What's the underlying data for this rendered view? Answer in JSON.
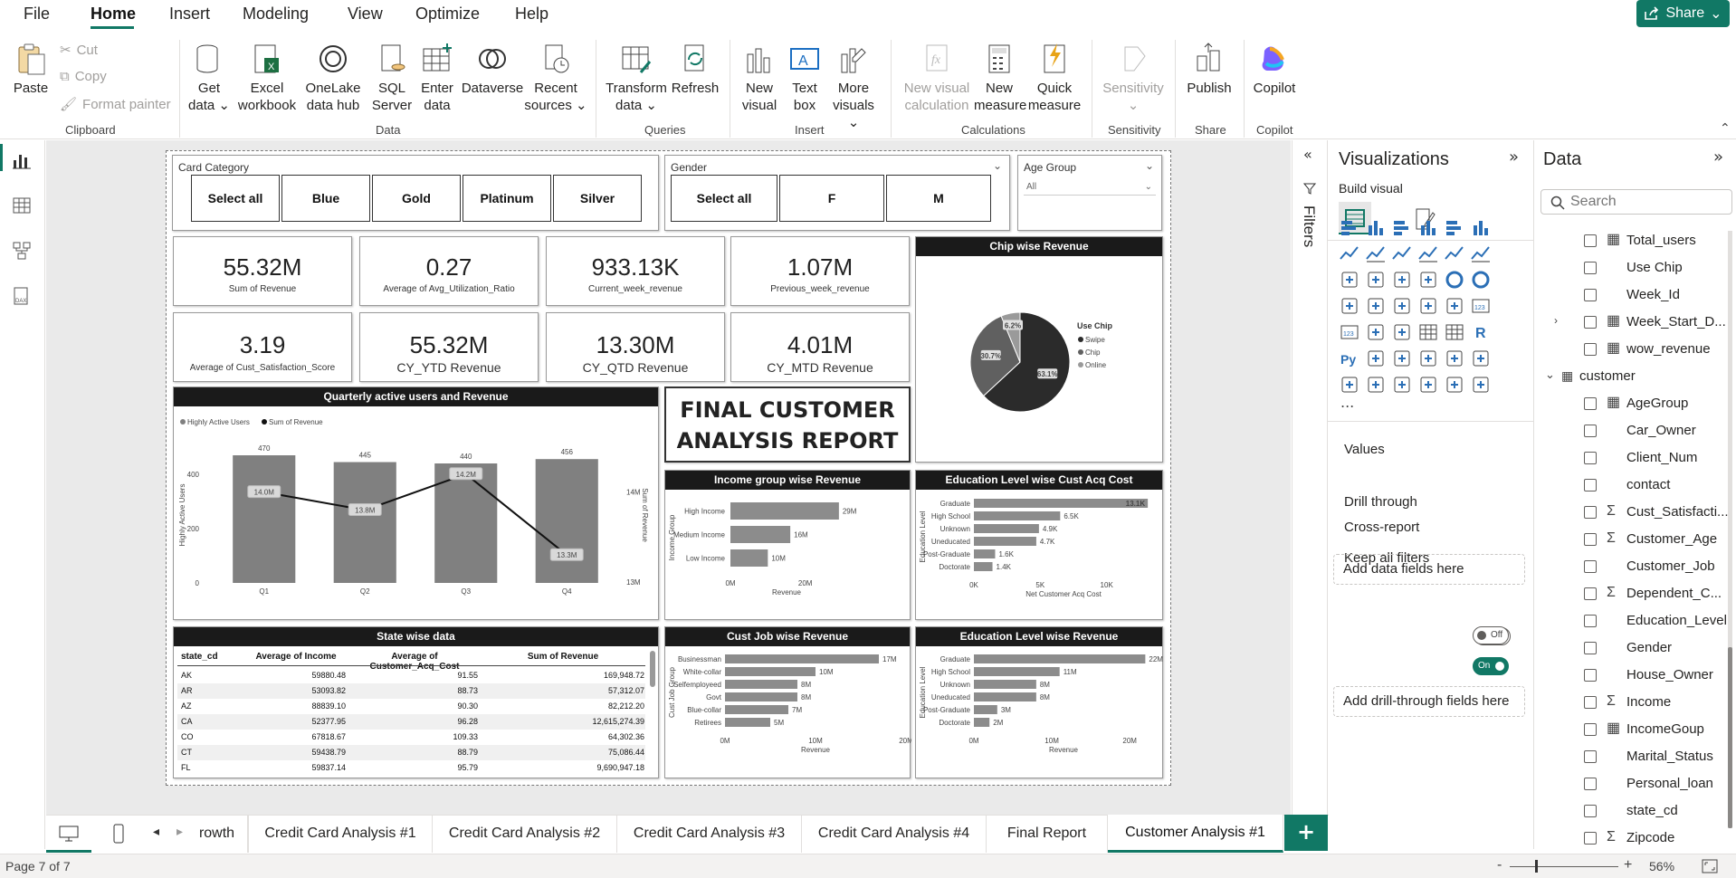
{
  "menu": {
    "file": "File",
    "home": "Home",
    "insert": "Insert",
    "modeling": "Modeling",
    "view": "View",
    "optimize": "Optimize",
    "help": "Help",
    "share": "Share"
  },
  "ribbon": {
    "paste": "Paste",
    "cut": "Cut",
    "copy": "Copy",
    "format_painter": "Format painter",
    "clipboard_group": "Clipboard",
    "get_data": "Get data",
    "excel_workbook": "Excel workbook",
    "onelake": "OneLake data hub",
    "sql_server": "SQL Server",
    "enter_data": "Enter data",
    "dataverse": "Dataverse",
    "recent_sources": "Recent sources",
    "data_group": "Data",
    "transform_data": "Transform data",
    "refresh": "Refresh",
    "queries_group": "Queries",
    "new_visual": "New visual",
    "text_box": "Text box",
    "more_visuals": "More visuals",
    "insert_group": "Insert",
    "new_visual_calc": "New visual calculation",
    "new_measure": "New measure",
    "quick_measure": "Quick measure",
    "calculations_group": "Calculations",
    "sensitivity": "Sensitivity",
    "sensitivity_group": "Sensitivity",
    "publish": "Publish",
    "share_group": "Share",
    "copilot": "Copilot",
    "copilot_group": "Copilot"
  },
  "report": {
    "card_category": {
      "title": "Card Category",
      "options": [
        "Select all",
        "Blue",
        "Gold",
        "Platinum",
        "Silver"
      ]
    },
    "gender": {
      "title": "Gender",
      "options": [
        "Select all",
        "F",
        "M"
      ]
    },
    "age_group": {
      "title": "Age Group",
      "value": "All"
    },
    "kpis": [
      {
        "value": "55.32M",
        "label": "Sum of Revenue"
      },
      {
        "value": "0.27",
        "label": "Average of Avg_Utilization_Ratio"
      },
      {
        "value": "933.13K",
        "label": "Current_week_revenue"
      },
      {
        "value": "1.07M",
        "label": "Previous_week_revenue"
      },
      {
        "value": "3.19",
        "label": "Average of Cust_Satisfaction_Score"
      },
      {
        "value": "55.32M",
        "label": "CY_YTD Revenue"
      },
      {
        "value": "13.30M",
        "label": "CY_QTD Revenue"
      },
      {
        "value": "4.01M",
        "label": "CY_MTD Revenue"
      }
    ],
    "report_title_line1": "FINAL CUSTOMER",
    "report_title_line2": "ANALYSIS REPORT",
    "state_table": {
      "title": "State wise data",
      "headers": [
        "state_cd",
        "Average of Income",
        "Average of Customer_Acq_Cost",
        "Sum of Revenue"
      ],
      "rows": [
        [
          "AK",
          "59880.48",
          "91.55",
          "169,948.72"
        ],
        [
          "AR",
          "53093.82",
          "88.73",
          "57,312.07"
        ],
        [
          "AZ",
          "88839.10",
          "90.30",
          "82,212.20"
        ],
        [
          "CA",
          "52377.95",
          "96.28",
          "12,615,274.39"
        ],
        [
          "CO",
          "67818.67",
          "109.33",
          "64,302.36"
        ],
        [
          "CT",
          "59438.79",
          "88.79",
          "75,086.44"
        ],
        [
          "FL",
          "59837.14",
          "95.79",
          "9,690,947.18"
        ]
      ]
    }
  },
  "chart_data": [
    {
      "type": "bar",
      "title": "Quarterly active users and Revenue",
      "legend": [
        "Highly Active Users",
        "Sum of Revenue"
      ],
      "legend_position": "top-left",
      "categories": [
        "Q1",
        "Q2",
        "Q3",
        "Q4"
      ],
      "series": [
        {
          "name": "Highly Active Users",
          "type": "bar",
          "values": [
            470,
            445,
            440,
            456
          ],
          "color": "#808080"
        },
        {
          "name": "Sum of Revenue",
          "type": "line",
          "values": [
            14.0,
            13.8,
            14.2,
            13.3
          ],
          "labels": [
            "14.0M",
            "13.8M",
            "14.2M",
            "13.3M"
          ],
          "color": "#111111"
        }
      ],
      "ylabel": "Highly Active Users",
      "y2label": "Sum of Revenue",
      "yticks": [
        0,
        200,
        400
      ],
      "y2ticks": [
        "13M",
        "14M"
      ],
      "ylim": [
        0,
        500
      ],
      "y2lim": [
        12.99,
        14.5
      ]
    },
    {
      "type": "pie",
      "title": "Chip wise Revenue",
      "legend_title": "Use Chip",
      "legend_position": "right",
      "labels": [
        "Swipe",
        "Chip",
        "Online"
      ],
      "values": [
        63.1,
        30.7,
        6.2
      ],
      "value_labels": [
        "63.1%",
        "30.7%",
        "6.2%"
      ],
      "colors": [
        "#2b2b2b",
        "#606060",
        "#9a9a9a"
      ]
    },
    {
      "type": "bar",
      "orientation": "horizontal",
      "title": "Income group wise Revenue",
      "categories": [
        "High Income",
        "Medium Income",
        "Low Income"
      ],
      "values": [
        29,
        16,
        10
      ],
      "value_labels": [
        "29M",
        "16M",
        "10M"
      ],
      "xlabel": "Revenue",
      "ylabel": "Income Group",
      "xticks": [
        "0M",
        "20M"
      ],
      "xlim": [
        0,
        30
      ]
    },
    {
      "type": "bar",
      "orientation": "horizontal",
      "title": "Education Level wise Cust Acq Cost",
      "categories": [
        "Graduate",
        "High School",
        "Unknown",
        "Uneducated",
        "Post-Graduate",
        "Doctorate"
      ],
      "values": [
        13.1,
        6.5,
        4.9,
        4.7,
        1.6,
        1.4
      ],
      "value_labels": [
        "13.1K",
        "6.5K",
        "4.9K",
        "4.7K",
        "1.6K",
        "1.4K"
      ],
      "xlabel": "Net Customer Acq Cost",
      "ylabel": "Education Level",
      "xticks": [
        "0K",
        "5K",
        "10K"
      ],
      "xlim": [
        0,
        13.5
      ]
    },
    {
      "type": "bar",
      "orientation": "horizontal",
      "title": "Cust Job wise Revenue",
      "categories": [
        "Businessman",
        "White-collar",
        "Selfemployeed",
        "Govt",
        "Blue-collar",
        "Retirees"
      ],
      "values": [
        17,
        10,
        8,
        8,
        7,
        5
      ],
      "value_labels": [
        "17M",
        "10M",
        "8M",
        "8M",
        "7M",
        "5M"
      ],
      "xlabel": "Revenue",
      "ylabel": "Cust Job Group",
      "xticks": [
        "0M",
        "10M",
        "20M"
      ],
      "xlim": [
        0,
        20
      ]
    },
    {
      "type": "bar",
      "orientation": "horizontal",
      "title": "Education Level wise Revenue",
      "categories": [
        "Graduate",
        "High School",
        "Unknown",
        "Uneducated",
        "Post-Graduate",
        "Doctorate"
      ],
      "values": [
        22,
        11,
        8,
        8,
        3,
        2
      ],
      "value_labels": [
        "22M",
        "11M",
        "8M",
        "8M",
        "3M",
        "2M"
      ],
      "xlabel": "Revenue",
      "ylabel": "Education Level",
      "xticks": [
        "0M",
        "10M",
        "20M"
      ],
      "xlim": [
        0,
        23
      ]
    }
  ],
  "filters_label": "Filters",
  "viz_pane": {
    "title": "Visualizations",
    "build_visual": "Build visual",
    "more": "...",
    "values_label": "Values",
    "values_well": "Add data fields here",
    "drill_through": "Drill through",
    "cross_report": "Cross-report",
    "cross_report_state": "Off",
    "keep_all_filters": "Keep all filters",
    "keep_all_filters_state": "On",
    "drill_well": "Add drill-through fields here"
  },
  "data_pane": {
    "title": "Data",
    "search_placeholder": "Search",
    "fields_top": [
      {
        "name": "Total_users",
        "icon": "calc-icon"
      },
      {
        "name": "Use Chip",
        "icon": ""
      },
      {
        "name": "Week_Id",
        "icon": ""
      },
      {
        "name": "Week_Start_D...",
        "icon": "hierarchy-icon"
      },
      {
        "name": "wow_revenue",
        "icon": "calc-icon"
      }
    ],
    "table_name": "customer",
    "fields": [
      {
        "name": "AgeGroup",
        "icon": "calc-column-icon"
      },
      {
        "name": "Car_Owner",
        "icon": ""
      },
      {
        "name": "Client_Num",
        "icon": ""
      },
      {
        "name": "contact",
        "icon": ""
      },
      {
        "name": "Cust_Satisfacti...",
        "icon": "sigma-icon"
      },
      {
        "name": "Customer_Age",
        "icon": "sigma-icon"
      },
      {
        "name": "Customer_Job",
        "icon": ""
      },
      {
        "name": "Dependent_C...",
        "icon": "sigma-icon"
      },
      {
        "name": "Education_Level",
        "icon": ""
      },
      {
        "name": "Gender",
        "icon": ""
      },
      {
        "name": "House_Owner",
        "icon": ""
      },
      {
        "name": "Income",
        "icon": "sigma-icon"
      },
      {
        "name": "IncomeGoup",
        "icon": "calc-column-icon"
      },
      {
        "name": "Marital_Status",
        "icon": ""
      },
      {
        "name": "Personal_loan",
        "icon": ""
      },
      {
        "name": "state_cd",
        "icon": ""
      },
      {
        "name": "Zipcode",
        "icon": "sigma-icon"
      }
    ]
  },
  "tabs": [
    "rowth",
    "Credit Card Analysis #1",
    "Credit Card Analysis #2",
    "Credit Card Analysis #3",
    "Credit Card Analysis #4",
    "Final Report",
    "Customer Analysis #1"
  ],
  "status": {
    "page": "Page 7 of 7",
    "zoom": "56%"
  },
  "colors": {
    "accent": "#117865",
    "bar": "#808080",
    "title_bg": "#1a1a1a"
  }
}
